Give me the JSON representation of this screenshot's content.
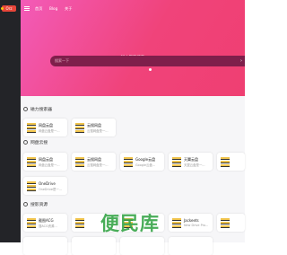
{
  "sidebar": {
    "logo": "Orz"
  },
  "nav": {
    "items": [
      "首页",
      "Blog",
      "关于"
    ]
  },
  "hero": {
    "tab": "磁力资源搜索",
    "placeholder": "搜索一下"
  },
  "sections": [
    {
      "title": "磁力搜索器",
      "cards": [
        {
          "name": "网盘云盘",
          "desc": "网盘云盘是一..."
        },
        {
          "name": "云搜网盘",
          "desc": "云搜网盘是一..."
        }
      ]
    },
    {
      "title": "网盘云搜",
      "cards": [
        {
          "name": "网盘云盘",
          "desc": "网盘云盘是一..."
        },
        {
          "name": "云搜网盘",
          "desc": "云搜网盘是一..."
        },
        {
          "name": "Google云盘",
          "desc": "Google云盘..."
        },
        {
          "name": "天翼云盘",
          "desc": "天翼云盘是一..."
        },
        {
          "name": "",
          "desc": ""
        },
        {
          "name": "OneDrive",
          "desc": "OneDrive是一..."
        }
      ]
    },
    {
      "title": "搜影资源",
      "cards": [
        {
          "name": "截图ACG",
          "desc": "搜ACG资源..."
        },
        {
          "name": "",
          "desc": ""
        },
        {
          "name": "",
          "desc": ""
        },
        {
          "name": "Jackeets",
          "desc": "New Drive Pro..."
        },
        {
          "name": "",
          "desc": ""
        }
      ]
    }
  ],
  "watermark": "便民库",
  "colors": {
    "accent": "#f0437a",
    "sidebar": "#232428"
  }
}
